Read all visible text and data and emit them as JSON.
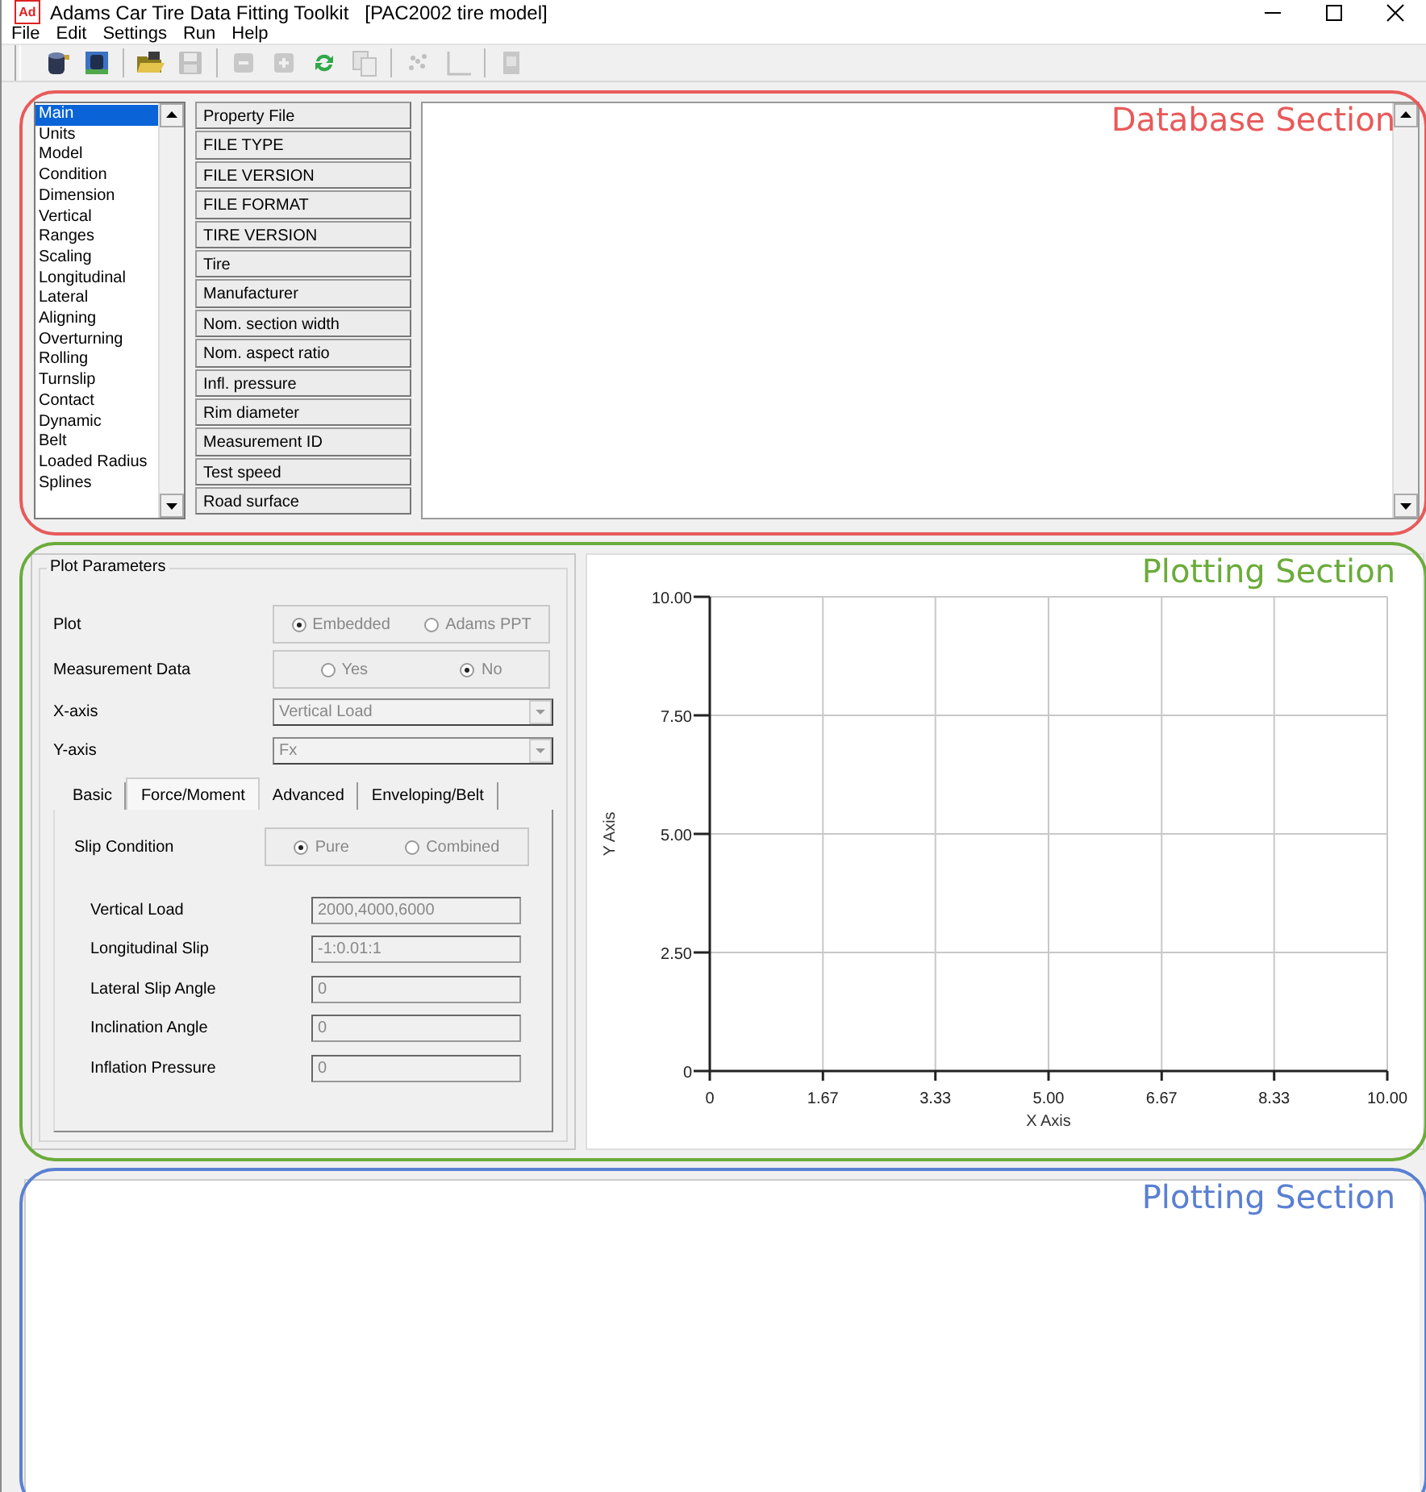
{
  "window": {
    "app_icon": "Ad",
    "title": "Adams Car Tire Data Fitting Toolkit   [PAC2002 tire model]"
  },
  "menu": [
    "File",
    "Edit",
    "Settings",
    "Run",
    "Help"
  ],
  "toolbar": [
    [
      {
        "kind": "database",
        "disabled": false
      },
      {
        "kind": "dbtable",
        "disabled": false
      }
    ],
    [
      {
        "kind": "folder",
        "disabled": false
      },
      {
        "kind": "save",
        "disabled": true
      }
    ],
    [
      {
        "kind": "minus",
        "disabled": true
      },
      {
        "kind": "plus",
        "disabled": true
      },
      {
        "kind": "refresh",
        "disabled": false
      },
      {
        "kind": "copy",
        "disabled": true
      }
    ],
    [
      {
        "kind": "scatter",
        "disabled": true
      },
      {
        "kind": "axes",
        "disabled": true
      }
    ],
    [
      {
        "kind": "page",
        "disabled": true
      }
    ]
  ],
  "database": {
    "sections": [
      {
        "label": "Main",
        "selected": true
      },
      {
        "label": "Units",
        "selected": false
      },
      {
        "label": "Model",
        "selected": false
      },
      {
        "label": "Condition",
        "selected": false
      },
      {
        "label": "Dimension",
        "selected": false
      },
      {
        "label": "Vertical",
        "selected": false
      },
      {
        "label": "Ranges",
        "selected": false
      },
      {
        "label": "Scaling",
        "selected": false
      },
      {
        "label": "Longitudinal",
        "selected": false
      },
      {
        "label": "Lateral",
        "selected": false
      },
      {
        "label": "Aligning",
        "selected": false
      },
      {
        "label": "Overturning",
        "selected": false
      },
      {
        "label": "Rolling",
        "selected": false
      },
      {
        "label": "Turnslip",
        "selected": false
      },
      {
        "label": "Contact",
        "selected": false
      },
      {
        "label": "Dynamic",
        "selected": false
      },
      {
        "label": "Belt",
        "selected": false
      },
      {
        "label": "Loaded Radius",
        "selected": false
      },
      {
        "label": "Splines",
        "selected": false
      }
    ],
    "properties": [
      "Property File",
      "FILE TYPE",
      "FILE VERSION",
      "FILE FORMAT",
      "TIRE VERSION",
      "Tire",
      "Manufacturer",
      "Nom. section width",
      "Nom. aspect ratio",
      "Infl. pressure",
      "Rim diameter",
      "Measurement ID",
      "Test speed",
      "Road surface"
    ]
  },
  "plot_parameters": {
    "title": "Plot Parameters",
    "disabled": true,
    "plot": {
      "label": "Plot",
      "options": [
        {
          "label": "Embedded",
          "selected": true
        },
        {
          "label": "Adams PPT",
          "selected": false
        }
      ]
    },
    "measurement_data": {
      "label": "Measurement Data",
      "options": [
        {
          "label": "Yes",
          "selected": false
        },
        {
          "label": "No",
          "selected": true
        }
      ]
    },
    "x_axis": {
      "label": "X-axis",
      "value": "Vertical Load"
    },
    "y_axis": {
      "label": "Y-axis",
      "value": "Fx"
    },
    "tabs": [
      {
        "label": "Basic",
        "selected": false
      },
      {
        "label": "Force/Moment",
        "selected": true
      },
      {
        "label": "Advanced",
        "selected": false
      },
      {
        "label": "Enveloping/Belt",
        "selected": false
      }
    ],
    "slip_condition": {
      "label": "Slip Condition",
      "options": [
        {
          "label": "Pure",
          "selected": true
        },
        {
          "label": "Combined",
          "selected": false
        }
      ]
    },
    "fields": [
      {
        "label": "Vertical Load",
        "value": "2000,4000,6000"
      },
      {
        "label": "Longitudinal Slip",
        "value": "-1:0.01:1"
      },
      {
        "label": "Lateral Slip Angle",
        "value": "0"
      },
      {
        "label": "Inclination Angle",
        "value": "0"
      },
      {
        "label": "Inflation Pressure",
        "value": "0"
      }
    ]
  },
  "chart": {
    "chart_data": {
      "type": "line",
      "grid": true,
      "xlabel": "X Axis",
      "ylabel": "Y Axis",
      "xlim": [
        0,
        10
      ],
      "ylim": [
        0,
        10
      ],
      "xticks": [
        {
          "value": 0,
          "label": "0"
        },
        {
          "value": 1.67,
          "label": "1.67"
        },
        {
          "value": 3.33,
          "label": "3.33"
        },
        {
          "value": 5,
          "label": "5.00"
        },
        {
          "value": 6.67,
          "label": "6.67"
        },
        {
          "value": 8.33,
          "label": "8.33"
        },
        {
          "value": 10,
          "label": "10.00"
        }
      ],
      "yticks": [
        {
          "value": 0,
          "label": "0"
        },
        {
          "value": 2.5,
          "label": "2.50"
        },
        {
          "value": 5,
          "label": "5.00"
        },
        {
          "value": 7.5,
          "label": "7.50"
        },
        {
          "value": 10,
          "label": "10.00"
        }
      ]
    }
  },
  "annotations": [
    {
      "label": "Database Section",
      "color": "#e85a5a"
    },
    {
      "label": "Plotting Section",
      "color": "#6bab3b"
    },
    {
      "label": "Plotting Section",
      "color": "#5a80d2"
    }
  ]
}
